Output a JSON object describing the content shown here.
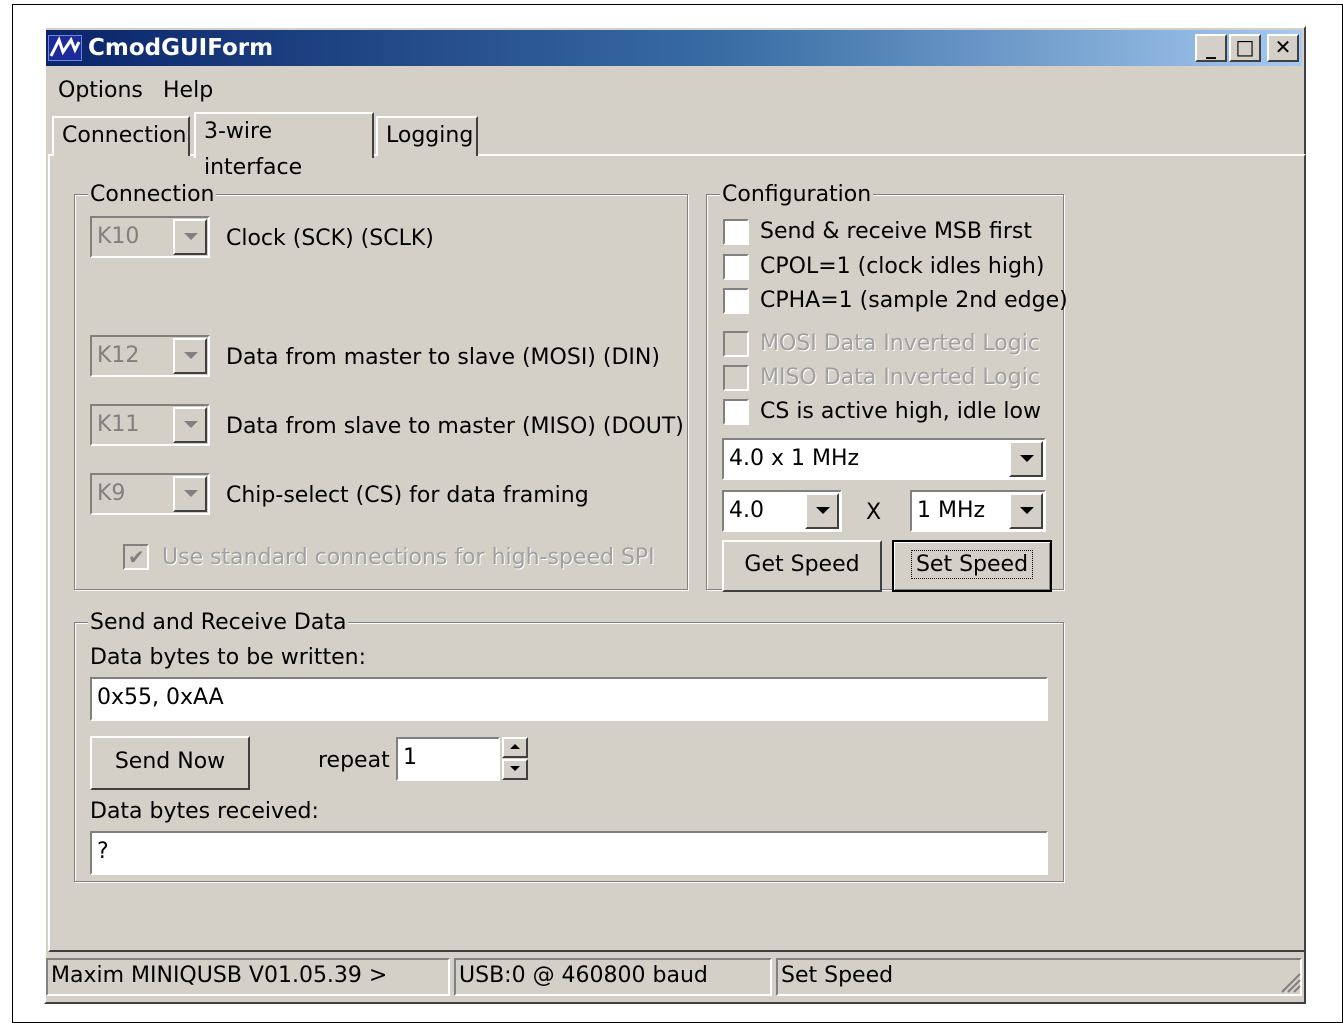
{
  "window": {
    "title": "CmodGUIForm",
    "minimize": "_",
    "maximize": "□",
    "close": "✕"
  },
  "menu": {
    "options": "Options",
    "help": "Help"
  },
  "tabs": [
    "Connection",
    "3-wire interface",
    "Logging"
  ],
  "connection": {
    "title": "Connection",
    "sck_value": "K10",
    "sck_label": "Clock (SCK) (SCLK)",
    "mosi_value": "K12",
    "mosi_label": "Data from master to slave (MOSI) (DIN)",
    "miso_value": "K11",
    "miso_label": "Data from slave to master (MISO) (DOUT)",
    "cs_value": "K9",
    "cs_label": "Chip-select (CS) for data framing",
    "std_conn_label": "Use standard connections for high-speed SPI",
    "std_conn_checked": true
  },
  "configuration": {
    "title": "Configuration",
    "msb_first": "Send & receive MSB first",
    "cpol": "CPOL=1 (clock idles high)",
    "cpha": "CPHA=1 (sample 2nd edge)",
    "mosi_inverted": "MOSI Data Inverted Logic",
    "miso_inverted": "MISO Data Inverted Logic",
    "cs_active_high": "CS is active high, idle low",
    "speed_combo": "4.0 x 1 MHz",
    "multiplier": "4.0",
    "times": "X",
    "unit": "1 MHz",
    "get_speed": "Get Speed",
    "set_speed": "Set Speed"
  },
  "send_receive": {
    "title": "Send and Receive Data",
    "write_label": "Data bytes to be written:",
    "write_value": "0x55, 0xAA",
    "send_now": "Send Now",
    "repeat_label": "repeat",
    "repeat_value": "1",
    "received_label": "Data bytes received:",
    "received_value": "?"
  },
  "statusbar": {
    "version": "Maxim MINIQUSB V01.05.39 >",
    "connection": "USB:0 @ 460800 baud",
    "action": "Set Speed"
  }
}
